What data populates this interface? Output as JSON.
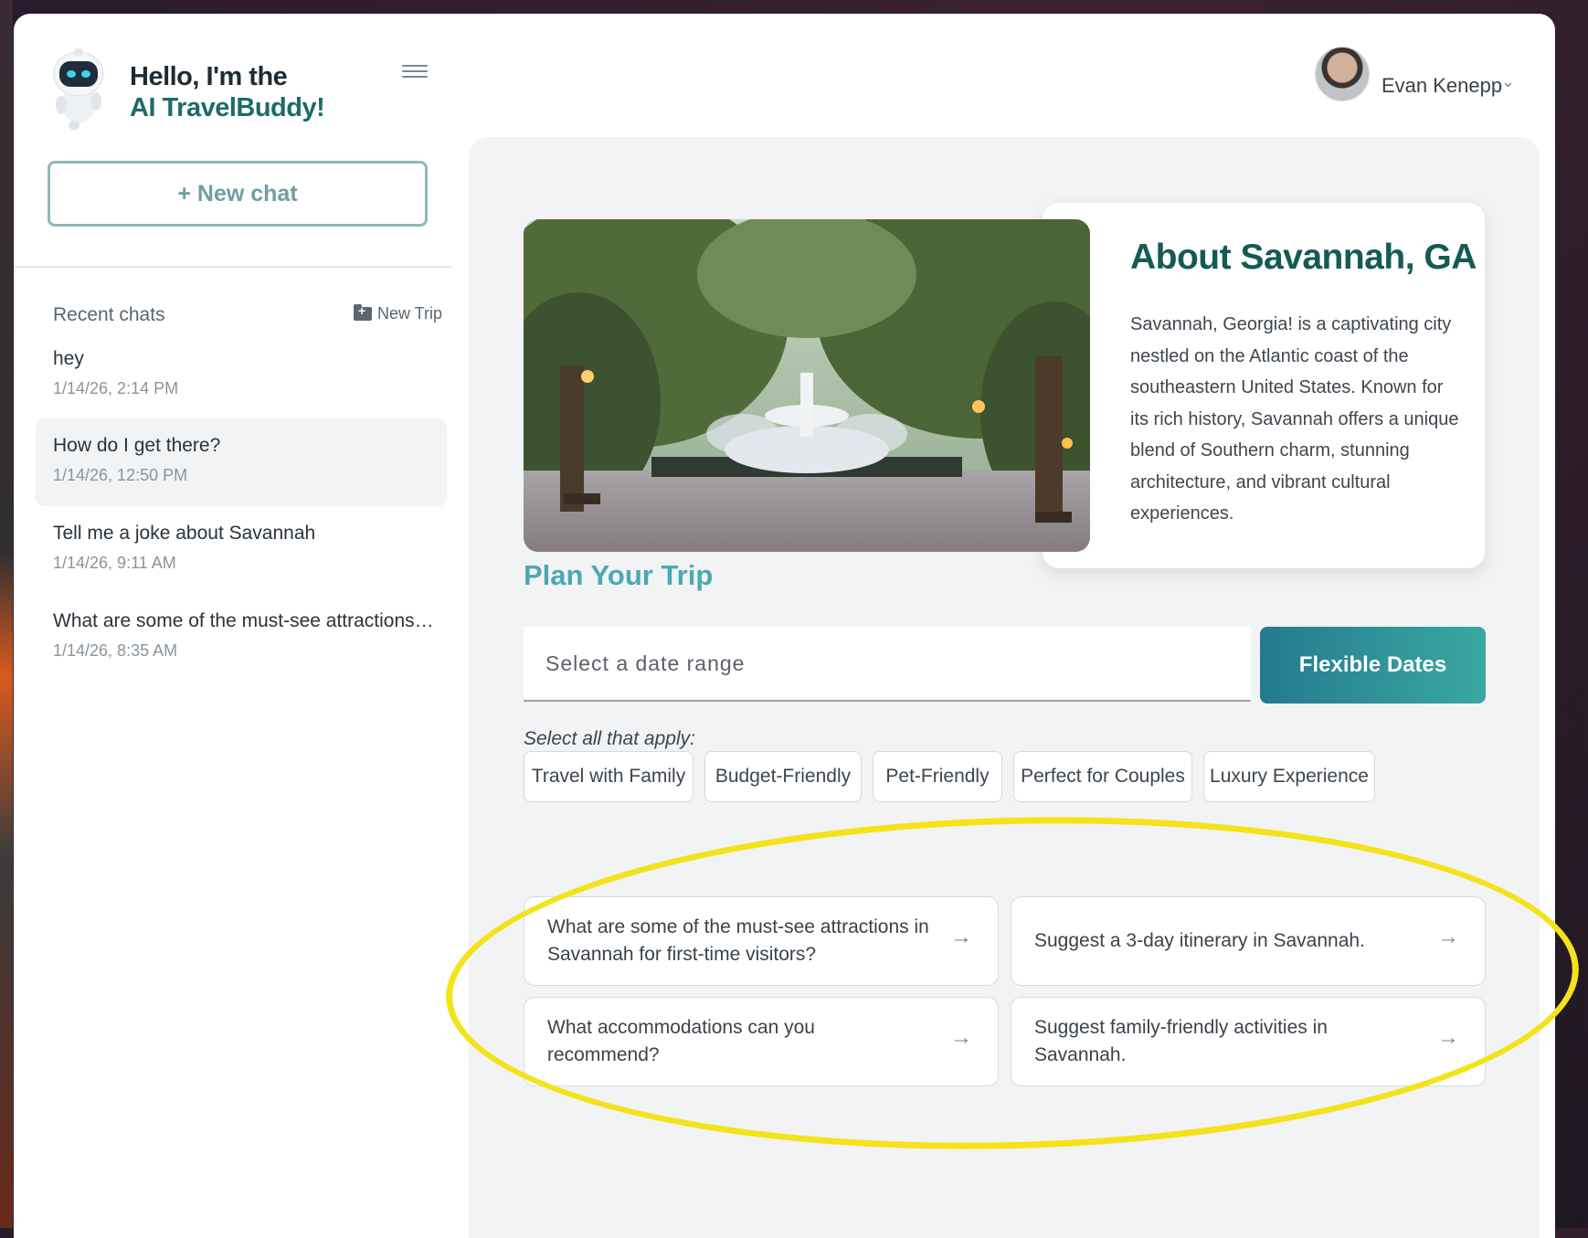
{
  "sidebar": {
    "greeting_line1": "Hello, I'm the",
    "greeting_line2": "AI TravelBuddy!",
    "new_chat_label": "+ New chat",
    "recent_label": "Recent chats",
    "new_trip_label": "New Trip",
    "chats": [
      {
        "title": "hey",
        "time": "1/14/26, 2:14 PM"
      },
      {
        "title": "How do I get there?",
        "time": "1/14/26, 12:50 PM"
      },
      {
        "title": "Tell me a joke about Savannah",
        "time": "1/14/26, 9:11 AM"
      },
      {
        "title": "What are some of the must-see attractions in Savann...",
        "time": "1/14/26, 8:35 AM"
      }
    ]
  },
  "user": {
    "name": "Evan Kenepp"
  },
  "about": {
    "title": "About Savannah, GA",
    "text": "Savannah, Georgia! is a captivating city nestled on the Atlantic coast of the southeastern United States. Known for its rich history, Savannah offers a unique blend of Southern charm, stunning architecture, and vibrant cultural experiences."
  },
  "plan": {
    "title": "Plan Your Trip",
    "date_placeholder": "Select a date range",
    "flexible_label": "Flexible Dates",
    "apply_label": "Select all that apply:",
    "chips": [
      "Travel with Family",
      "Budget-Friendly",
      "Pet-Friendly",
      "Perfect for Couples",
      "Luxury Experience"
    ]
  },
  "suggestions": [
    "What are some of the must-see attractions in Savannah for first-time visitors?",
    "Suggest a 3-day itinerary in Savannah.",
    "What accommodations can you recommend?",
    "Suggest family-friendly activities in Savannah."
  ],
  "colors": {
    "brand_teal": "#1d6b68",
    "accent": "#4aa9b3",
    "highlight": "#f4e21a"
  },
  "icons": [
    "robot-mascot-icon",
    "hamburger-menu-icon",
    "folder-plus-icon",
    "chevron-down-icon",
    "arrow-right-icon"
  ]
}
